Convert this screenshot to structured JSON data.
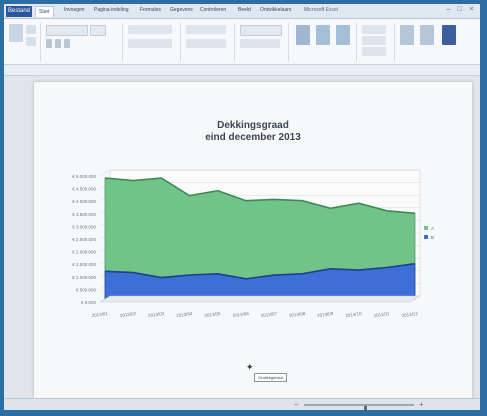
{
  "ribbon": {
    "file_tab": "Bestand",
    "tabs": [
      "Start",
      "Invoegen",
      "Pagina-indeling",
      "Formules",
      "Gegevens",
      "Controleren",
      "Beeld",
      "Ontwikkelaars"
    ],
    "active_tab": "Start"
  },
  "window": {
    "title": "Microsoft Excel"
  },
  "chart": {
    "title_line1": "Dekkingsgraad",
    "title_line2": "eind december 2013"
  },
  "chart_data": {
    "type": "area",
    "title": "Dekkingsgraad eind december 2013",
    "ylim": [
      0,
      5000000
    ],
    "yticks": [
      0,
      500000,
      1000000,
      1500000,
      2000000,
      2500000,
      3000000,
      3500000,
      4000000,
      4500000,
      5000000
    ],
    "ytick_labels": [
      "€ 0,000",
      "€ 500.000",
      "€ 1.000.000",
      "€ 1.500.000",
      "€ 2.000.000",
      "€ 2.500.000",
      "€ 3.000.000",
      "€ 3.500.000",
      "€ 4.000.000",
      "€ 4.500.000",
      "€ 5.000.000"
    ],
    "categories": [
      "2013/01",
      "2013/02",
      "2013/03",
      "2013/04",
      "2013/05",
      "2013/06",
      "2013/07",
      "2013/08",
      "2013/09",
      "2013/10",
      "2013/11",
      "2013/12"
    ],
    "series": [
      {
        "values": [
          4800000,
          4700000,
          4800000,
          4100000,
          4300000,
          3900000,
          3950000,
          3900000,
          3600000,
          3800000,
          3500000,
          3400000
        ],
        "color": "#72c38a"
      },
      {
        "values": [
          1100000,
          1050000,
          850000,
          950000,
          1000000,
          800000,
          950000,
          1000000,
          1200000,
          1150000,
          1250000,
          1400000
        ],
        "color": "#3d6fd6"
      }
    ],
    "legend": {
      "placement": "right",
      "entries": [
        "A",
        "B"
      ]
    },
    "grid": true
  },
  "tooltip": {
    "text": "Grafiekgebied"
  },
  "colors": {
    "accent": "#2b579a",
    "green": "#72c38a",
    "blue": "#3d6fd6"
  }
}
